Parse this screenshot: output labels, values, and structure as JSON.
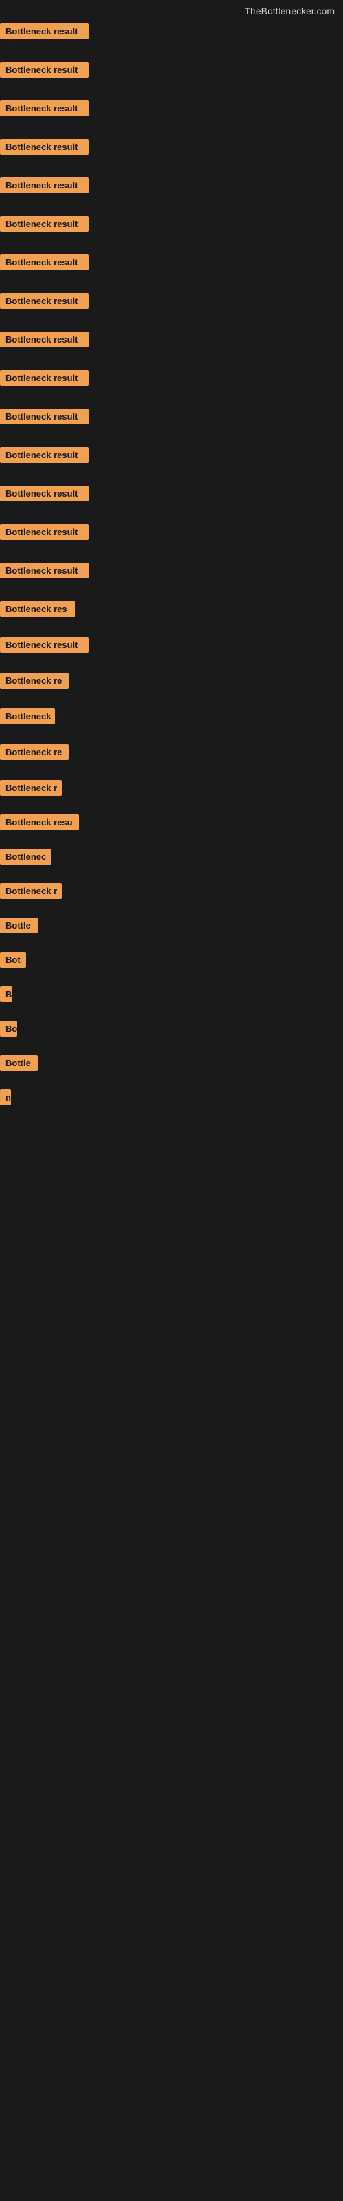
{
  "site": {
    "title": "TheBottlenecker.com"
  },
  "items": [
    {
      "id": 1,
      "label": "Bottleneck result",
      "width": 130
    },
    {
      "id": 2,
      "label": "Bottleneck result",
      "width": 130
    },
    {
      "id": 3,
      "label": "Bottleneck result",
      "width": 130
    },
    {
      "id": 4,
      "label": "Bottleneck result",
      "width": 130
    },
    {
      "id": 5,
      "label": "Bottleneck result",
      "width": 130
    },
    {
      "id": 6,
      "label": "Bottleneck result",
      "width": 130
    },
    {
      "id": 7,
      "label": "Bottleneck result",
      "width": 130
    },
    {
      "id": 8,
      "label": "Bottleneck result",
      "width": 130
    },
    {
      "id": 9,
      "label": "Bottleneck result",
      "width": 130
    },
    {
      "id": 10,
      "label": "Bottleneck result",
      "width": 130
    },
    {
      "id": 11,
      "label": "Bottleneck result",
      "width": 130
    },
    {
      "id": 12,
      "label": "Bottleneck result",
      "width": 130
    },
    {
      "id": 13,
      "label": "Bottleneck result",
      "width": 130
    },
    {
      "id": 14,
      "label": "Bottleneck result",
      "width": 130
    },
    {
      "id": 15,
      "label": "Bottleneck result",
      "width": 130
    },
    {
      "id": 16,
      "label": "Bottleneck res",
      "width": 110
    },
    {
      "id": 17,
      "label": "Bottleneck result",
      "width": 130
    },
    {
      "id": 18,
      "label": "Bottleneck re",
      "width": 100
    },
    {
      "id": 19,
      "label": "Bottleneck",
      "width": 80
    },
    {
      "id": 20,
      "label": "Bottleneck re",
      "width": 100
    },
    {
      "id": 21,
      "label": "Bottleneck r",
      "width": 90
    },
    {
      "id": 22,
      "label": "Bottleneck resu",
      "width": 115
    },
    {
      "id": 23,
      "label": "Bottlenec",
      "width": 75
    },
    {
      "id": 24,
      "label": "Bottleneck r",
      "width": 90
    },
    {
      "id": 25,
      "label": "Bottle",
      "width": 55
    },
    {
      "id": 26,
      "label": "Bot",
      "width": 38
    },
    {
      "id": 27,
      "label": "B",
      "width": 18
    },
    {
      "id": 28,
      "label": "Bo",
      "width": 25
    },
    {
      "id": 29,
      "label": "Bottle",
      "width": 55
    },
    {
      "id": 30,
      "label": "n",
      "width": 12
    }
  ],
  "colors": {
    "background": "#1a1a1a",
    "label_bg": "#f0a050",
    "label_text": "#1a1a1a",
    "title_text": "#cccccc"
  }
}
